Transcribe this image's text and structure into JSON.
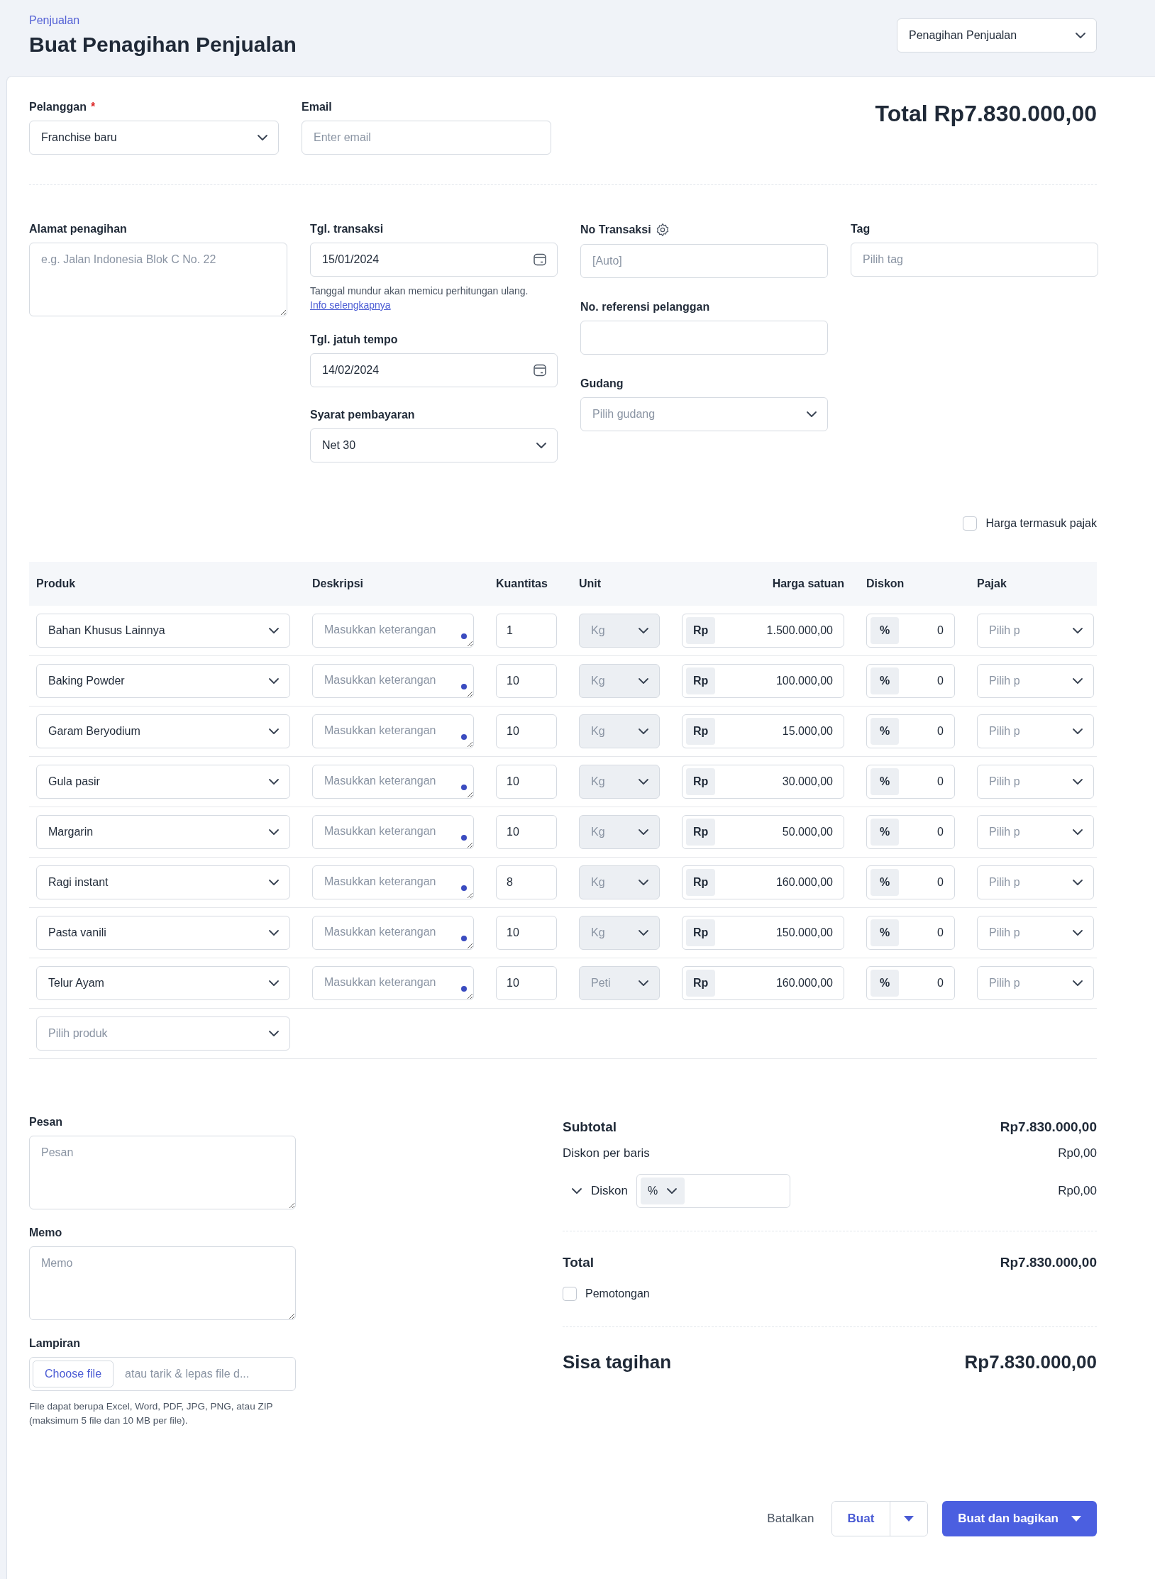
{
  "breadcrumb": "Penjualan",
  "title": "Buat Penagihan Penjualan",
  "doc_type": "Penagihan Penjualan",
  "customer": {
    "label": "Pelanggan",
    "required_mark": "*",
    "value": "Franchise baru"
  },
  "email": {
    "label": "Email",
    "placeholder": "Enter email"
  },
  "total_heading": "Total Rp7.830.000,00",
  "billing_address": {
    "label": "Alamat penagihan",
    "placeholder": "e.g. Jalan Indonesia Blok C No. 22"
  },
  "transaction_date": {
    "label": "Tgl. transaksi",
    "value": "15/01/2024",
    "hint": "Tanggal mundur akan memicu perhitungan ulang.",
    "link": "Info selengkapnya"
  },
  "due_date": {
    "label": "Tgl. jatuh tempo",
    "value": "14/02/2024"
  },
  "payment_terms": {
    "label": "Syarat pembayaran",
    "value": "Net 30"
  },
  "transaction_no": {
    "label": "No Transaksi",
    "placeholder": "[Auto]"
  },
  "customer_ref": {
    "label": "No. referensi pelanggan"
  },
  "warehouse": {
    "label": "Gudang",
    "placeholder": "Pilih gudang"
  },
  "tag": {
    "label": "Tag",
    "placeholder": "Pilih tag"
  },
  "tax_inclusive": {
    "label": "Harga termasuk pajak",
    "checked": false
  },
  "table": {
    "columns": [
      "Produk",
      "Deskripsi",
      "Kuantitas",
      "Unit",
      "Harga satuan",
      "Diskon",
      "Pajak"
    ],
    "rows": [
      {
        "product": "Bahan Khusus Lainnya",
        "description_placeholder": "Masukkan keterangan",
        "quantity": "1",
        "unit": "Kg",
        "currency": "Rp",
        "price": "1.500.000,00",
        "discount_unit": "%",
        "discount": "0",
        "tax_placeholder": "Pilih p"
      },
      {
        "product": "Baking Powder",
        "description_placeholder": "Masukkan keterangan",
        "quantity": "10",
        "unit": "Kg",
        "currency": "Rp",
        "price": "100.000,00",
        "discount_unit": "%",
        "discount": "0",
        "tax_placeholder": "Pilih p"
      },
      {
        "product": "Garam Beryodium",
        "description_placeholder": "Masukkan keterangan",
        "quantity": "10",
        "unit": "Kg",
        "currency": "Rp",
        "price": "15.000,00",
        "discount_unit": "%",
        "discount": "0",
        "tax_placeholder": "Pilih p"
      },
      {
        "product": "Gula pasir",
        "description_placeholder": "Masukkan keterangan",
        "quantity": "10",
        "unit": "Kg",
        "currency": "Rp",
        "price": "30.000,00",
        "discount_unit": "%",
        "discount": "0",
        "tax_placeholder": "Pilih p"
      },
      {
        "product": "Margarin",
        "description_placeholder": "Masukkan keterangan",
        "quantity": "10",
        "unit": "Kg",
        "currency": "Rp",
        "price": "50.000,00",
        "discount_unit": "%",
        "discount": "0",
        "tax_placeholder": "Pilih p"
      },
      {
        "product": "Ragi instant",
        "description_placeholder": "Masukkan keterangan",
        "quantity": "8",
        "unit": "Kg",
        "currency": "Rp",
        "price": "160.000,00",
        "discount_unit": "%",
        "discount": "0",
        "tax_placeholder": "Pilih p"
      },
      {
        "product": "Pasta vanili",
        "description_placeholder": "Masukkan keterangan",
        "quantity": "10",
        "unit": "Kg",
        "currency": "Rp",
        "price": "150.000,00",
        "discount_unit": "%",
        "discount": "0",
        "tax_placeholder": "Pilih p"
      },
      {
        "product": "Telur Ayam",
        "description_placeholder": "Masukkan keterangan",
        "quantity": "10",
        "unit": "Peti",
        "currency": "Rp",
        "price": "160.000,00",
        "discount_unit": "%",
        "discount": "0",
        "tax_placeholder": "Pilih p"
      }
    ],
    "add_product_placeholder": "Pilih produk"
  },
  "message": {
    "label": "Pesan",
    "placeholder": "Pesan"
  },
  "memo": {
    "label": "Memo",
    "placeholder": "Memo"
  },
  "attachment": {
    "label": "Lampiran",
    "button": "Choose file",
    "drop_text": "atau tarik & lepas file d...",
    "hint": "File dapat berupa Excel, Word, PDF, JPG, PNG, atau ZIP (maksimum 5 file dan 10 MB per file)."
  },
  "summary": {
    "subtotal_label": "Subtotal",
    "subtotal": "Rp7.830.000,00",
    "line_discount_label": "Diskon per baris",
    "line_discount": "Rp0,00",
    "discount_label": "Diskon",
    "discount_unit": "%",
    "discount": "Rp0,00",
    "total_label": "Total",
    "total": "Rp7.830.000,00",
    "withholding": {
      "label": "Pemotongan",
      "checked": false
    },
    "balance_label": "Sisa tagihan",
    "balance": "Rp7.830.000,00"
  },
  "actions": {
    "cancel": "Batalkan",
    "create": "Buat",
    "create_share": "Buat dan bagikan"
  }
}
